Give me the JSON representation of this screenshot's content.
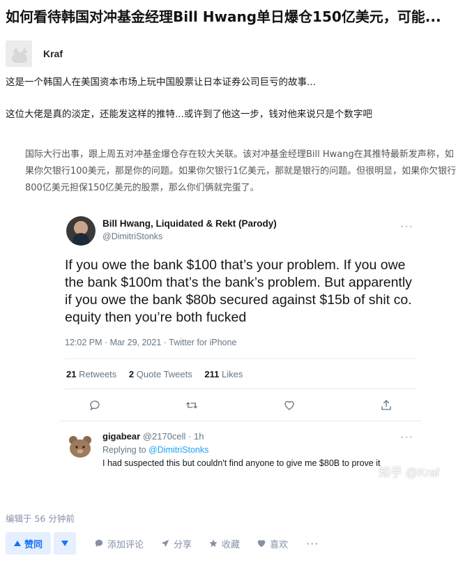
{
  "question": {
    "title": "如何看待韩国对冲基金经理Bill Hwang单日爆仓150亿美元，可能..."
  },
  "author": {
    "name": "Kraf"
  },
  "answer": {
    "paragraph1": "这是一个韩国人在美国资本市场上玩中国股票让日本证券公司巨亏的故事...",
    "paragraph2": "这位大佬是真的淡定，还能发这样的推特...或许到了他这一步，钱对他来说只是个数字吧",
    "quote": "国际大行出事，跟上周五对冲基金爆仓存在较大关联。该对冲基金经理Bill Hwang在其推特最新发声称，如果你欠银行100美元，那是你的问题。如果你欠银行1亿美元，那就是银行的问题。但很明显，如果你欠银行800亿美元担保150亿美元的股票，那么你们俩就完蛋了。"
  },
  "tweet": {
    "display_name": "Bill Hwang, Liquidated & Rekt (Parody)",
    "handle": "@DimitriStonks",
    "text": "If you owe the bank $100 that’s your problem. If you owe the bank $100m that’s the bank’s problem. But apparently if you owe the bank $80b secured against $15b of shit co. equity then you’re both fucked",
    "meta": "12:02 PM · Mar 29, 2021 · Twitter for iPhone",
    "retweets_count": "21",
    "retweets_label": "Retweets",
    "quote_count": "2",
    "quote_label": "Quote Tweets",
    "likes_count": "211",
    "likes_label": "Likes",
    "icons": [
      "reply-icon",
      "retweet-icon",
      "like-icon",
      "share-icon"
    ],
    "reply": {
      "name": "gigabear",
      "handle_time": "@2170cell · 1h",
      "replying_prefix": "Replying to",
      "replying_to": "@DimitriStonks",
      "text": "I had suspected this but couldn't find anyone to give me $80B to prove it"
    },
    "watermark": "知乎 @Kraf"
  },
  "footer": {
    "edited": "编辑于 56 分钟前"
  },
  "actions": {
    "upvote": "赞同",
    "comment": "添加评论",
    "share": "分享",
    "collect": "收藏",
    "like": "喜欢",
    "accent": "#1772f6",
    "muted": "#8590a6"
  }
}
